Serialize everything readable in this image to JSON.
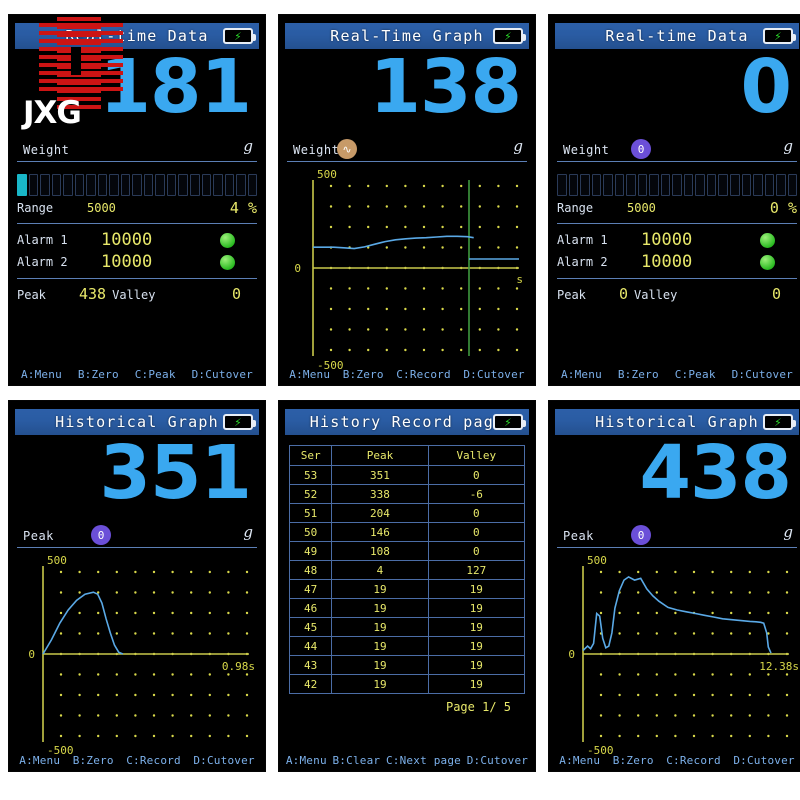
{
  "panels": [
    {
      "id": "realtime-data-1",
      "title": "Real-time Data",
      "battery_icon": "battery-charging-icon",
      "value": "181",
      "unit": "g",
      "mode_label": "Weight",
      "mode_icon": "",
      "range_label": "Range",
      "range_value": "5000",
      "percent": "4 %",
      "bar_segments": 21,
      "bar_filled": 1,
      "alarm1_label": "Alarm 1",
      "alarm1_value": "10000",
      "alarm2_label": "Alarm 2",
      "alarm2_value": "10000",
      "peak_label": "Peak",
      "peak_value": "438",
      "valley_label": "Valley",
      "valley_value": "0",
      "footer": [
        "A:Menu",
        "B:Zero",
        "C:Peak",
        "D:Cutover"
      ]
    },
    {
      "id": "realtime-graph",
      "title": "Real-Time Graph",
      "battery_icon": "battery-charging-icon",
      "value": "138",
      "unit": "g",
      "mode_label": "Weight",
      "mode_icon": "wave-icon",
      "y_top": "500",
      "y_zero": "0",
      "y_bottom": "-500",
      "x_label": "s",
      "footer": [
        "A:Menu",
        "B:Zero",
        "C:Record",
        "D:Cutover"
      ]
    },
    {
      "id": "realtime-data-2",
      "title": "Real-time Data",
      "battery_icon": "battery-charging-icon",
      "value": "0",
      "unit": "g",
      "mode_label": "Weight",
      "mode_icon": "zero-icon",
      "range_label": "Range",
      "range_value": "5000",
      "percent": "0 %",
      "bar_segments": 21,
      "bar_filled": 0,
      "alarm1_label": "Alarm 1",
      "alarm1_value": "10000",
      "alarm2_label": "Alarm 2",
      "alarm2_value": "10000",
      "peak_label": "Peak",
      "peak_value": "0",
      "valley_label": "Valley",
      "valley_value": "0",
      "footer": [
        "A:Menu",
        "B:Zero",
        "C:Peak",
        "D:Cutover"
      ]
    },
    {
      "id": "historical-graph-1",
      "title": "Historical Graph",
      "battery_icon": "battery-charging-icon",
      "value": "351",
      "unit": "g",
      "mode_label": "Peak",
      "mode_icon": "zero-icon",
      "y_top": "500",
      "y_zero": "0",
      "y_bottom": "-500",
      "x_label": "0.98s",
      "footer": [
        "A:Menu",
        "B:Zero",
        "C:Record",
        "D:Cutover"
      ]
    },
    {
      "id": "history-record-page",
      "title": "History Record page",
      "battery_icon": "battery-charging-icon",
      "columns": [
        "Ser",
        "Peak",
        "Valley"
      ],
      "rows": [
        [
          "53",
          "351",
          "0"
        ],
        [
          "52",
          "338",
          "-6"
        ],
        [
          "51",
          "204",
          "0"
        ],
        [
          "50",
          "146",
          "0"
        ],
        [
          "49",
          "108",
          "0"
        ],
        [
          "48",
          "4",
          "127"
        ],
        [
          "47",
          "19",
          "19"
        ],
        [
          "46",
          "19",
          "19"
        ],
        [
          "45",
          "19",
          "19"
        ],
        [
          "44",
          "19",
          "19"
        ],
        [
          "43",
          "19",
          "19"
        ],
        [
          "42",
          "19",
          "19"
        ]
      ],
      "page_info": "Page 1/ 5",
      "footer": [
        "A:Menu",
        "B:Clear",
        "C:Next page",
        "D:Cutover"
      ]
    },
    {
      "id": "historical-graph-2",
      "title": "Historical Graph",
      "battery_icon": "battery-charging-icon",
      "value": "438",
      "unit": "g",
      "mode_label": "Peak",
      "mode_icon": "zero-icon",
      "y_top": "500",
      "y_zero": "0",
      "y_bottom": "-500",
      "x_label": "12.38s",
      "footer": [
        "A:Menu",
        "B:Zero",
        "C:Record",
        "D:Cutover"
      ]
    }
  ],
  "watermark": {
    "text": "JXG",
    "bar_color": "#cc1414"
  },
  "chart_data": [
    {
      "type": "line",
      "title": "Real-Time Graph",
      "ylabel": "Weight (g)",
      "xlabel": "s",
      "ylim": [
        -500,
        500
      ],
      "grid": "dot",
      "cursor_x_fraction": 0.78,
      "series": [
        {
          "name": "Weight",
          "color": "#5aa9e6",
          "x": [
            0,
            0.05,
            0.1,
            0.15,
            0.2,
            0.25,
            0.3,
            0.35,
            0.4,
            0.45,
            0.5,
            0.55,
            0.6,
            0.65,
            0.7,
            0.75,
            0.78
          ],
          "values": [
            118,
            118,
            118,
            115,
            110,
            120,
            135,
            150,
            160,
            166,
            170,
            172,
            176,
            180,
            180,
            178,
            172
          ]
        }
      ]
    },
    {
      "type": "line",
      "title": "Historical Graph",
      "ylabel": "Peak (g)",
      "xlabel": "0.98s",
      "ylim": [
        -500,
        500
      ],
      "grid": "dot",
      "series": [
        {
          "name": "Peak",
          "color": "#5aa9e6",
          "x": [
            0.0,
            0.04,
            0.08,
            0.12,
            0.16,
            0.2,
            0.24,
            0.26,
            0.28,
            0.3,
            0.32,
            0.34,
            0.36,
            0.38
          ],
          "values": [
            0,
            80,
            175,
            250,
            305,
            340,
            351,
            340,
            290,
            200,
            120,
            50,
            10,
            0
          ]
        }
      ]
    },
    {
      "type": "line",
      "title": "Historical Graph",
      "ylabel": "Peak (g)",
      "xlabel": "12.38s",
      "ylim": [
        -500,
        500
      ],
      "grid": "dot",
      "series": [
        {
          "name": "Peak",
          "color": "#5aa9e6",
          "x": [
            0.0,
            0.3,
            0.5,
            0.7,
            0.9,
            1.1,
            1.3,
            1.5,
            1.7,
            1.9,
            2.1,
            2.4,
            2.7,
            3.0,
            3.4,
            3.8,
            4.2,
            4.6,
            5.0,
            5.6,
            6.2,
            6.8,
            7.4,
            8.0,
            8.6,
            9.2,
            9.8,
            10.4,
            11.0,
            11.4,
            11.7,
            11.9,
            12.1,
            12.2,
            12.38
          ],
          "values": [
            20,
            45,
            30,
            60,
            230,
            215,
            90,
            35,
            45,
            120,
            260,
            360,
            420,
            438,
            420,
            430,
            370,
            330,
            300,
            265,
            250,
            240,
            230,
            220,
            210,
            200,
            195,
            190,
            185,
            183,
            180,
            175,
            120,
            40,
            5
          ]
        }
      ]
    }
  ]
}
